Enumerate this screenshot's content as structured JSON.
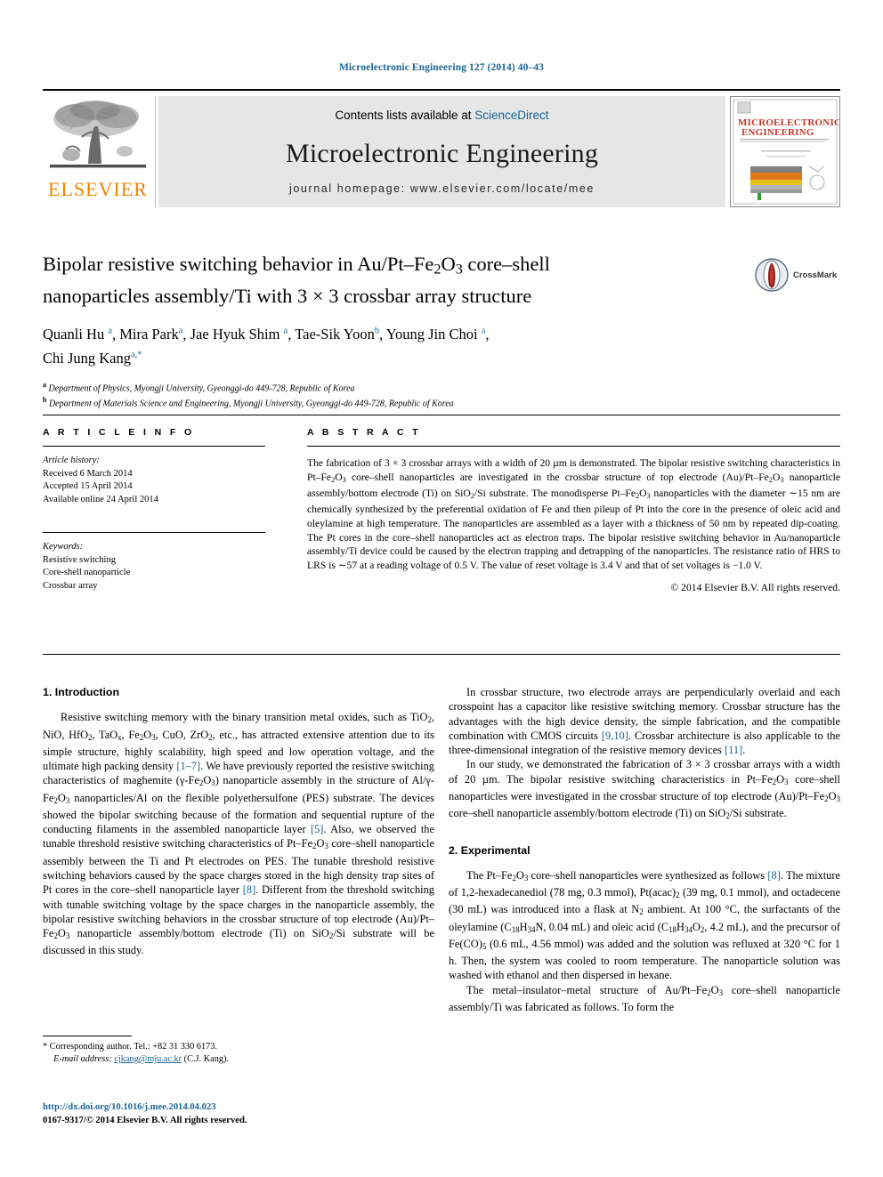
{
  "running_head": "Microelectronic Engineering 127 (2014) 40–43",
  "masthead": {
    "contents_label": "Contents lists available at",
    "sciencedirect_link": "ScienceDirect",
    "journal_title": "Microelectronic Engineering",
    "homepage_label": "journal homepage: www.elsevier.com/locate/mee",
    "publisher_wordmark": "ELSEVIER",
    "cover_title_line1": "MICROELECTRONIC",
    "cover_title_line2": "ENGINEERING"
  },
  "article": {
    "title_line1": "Bipolar resistive switching behavior in Au/Pt–Fe2O3 core–shell",
    "title_line2": "nanoparticles assembly/Ti with 3 × 3 crossbar array structure",
    "authors": "Quanli Hu a, Mira Park a, Jae Hyuk Shim a, Tae-Sik Yoon b, Young Jin Choi a, Chi Jung Kang a,*",
    "affiliation_a": "Department of Physics, Myongji University, Gyeonggi-do 449-728, Republic of Korea",
    "affiliation_b": "Department of Materials Science and Engineering, Myongji University, Gyeonggi-do 449-728, Republic of Korea",
    "crossmark_label": "CrossMark"
  },
  "article_info": {
    "heading": "A R T I C L E    I N F O",
    "history_label": "Article history:",
    "received": "Received 6 March 2014",
    "accepted": "Accepted 15 April 2014",
    "available_online": "Available online 24 April 2014",
    "keywords_label": "Keywords:",
    "keywords": [
      "Resistive switching",
      "Core-shell nanoparticle",
      "Crossbar array"
    ]
  },
  "abstract": {
    "heading": "A B S T R A C T",
    "text": "The fabrication of 3 × 3 crossbar arrays with a width of 20 µm is demonstrated. The bipolar resistive switching characteristics in Pt–Fe2O3 core–shell nanoparticles are investigated in the crossbar structure of top electrode (Au)/Pt–Fe2O3 nanoparticle assembly/bottom electrode (Ti) on SiO2/Si substrate. The monodisperse Pt–Fe2O3 nanoparticles with the diameter ~15 nm are chemically synthesized by the preferential oxidation of Fe and then pileup of Pt into the core in the presence of oleic acid and oleylamine at high temperature. The nanoparticles are assembled as a layer with a thickness of 50 nm by repeated dip-coating. The Pt cores in the core–shell nanoparticles act as electron traps. The bipolar resistive switching behavior in Au/nanoparticle assembly/Ti device could be caused by the electron trapping and detrapping of the nanoparticles. The resistance ratio of HRS to LRS is ~57 at a reading voltage of 0.5 V. The value of reset voltage is 3.4 V and that of set voltages is −1.0 V.",
    "copyright": "© 2014 Elsevier B.V. All rights reserved."
  },
  "sections": {
    "introduction_heading": "1. Introduction",
    "experimental_heading": "2. Experimental",
    "intro_p1": "Resistive switching memory with the binary transition metal oxides, such as TiO2, NiO, HfO2, TaOx, Fe2O3, CuO, ZrO2, etc., has attracted extensive attention due to its simple structure, highly scalability, high speed and low operation voltage, and the ultimate high packing density [1–7]. We have previously reported the resistive switching characteristics of maghemite (γ-Fe2O3) nanoparticle assembly in the structure of Al/γ-Fe2O3 nanoparticles/Al on the flexible polyethersulfone (PES) substrate. The devices showed the bipolar switching because of the formation and sequential rupture of the conducting filaments in the assembled nanoparticle layer [5]. Also, we observed the tunable threshold resistive switching characteristics of Pt–Fe2O3 core–shell nanoparticle assembly between the Ti and Pt electrodes on PES. The tunable threshold resistive switching behaviors caused by the space charges stored in the high density trap sites of Pt cores in the core–shell nanoparticle layer [8]. Different from the threshold switching with tunable switching voltage by the space charges in the nanoparticle assembly, the bipolar resistive switching behaviors in the crossbar structure of top electrode (Au)/Pt–Fe2O3 nanoparticle assembly/bottom electrode (Ti) on SiO2/Si substrate will be discussed in this study.",
    "intro_p2": "In crossbar structure, two electrode arrays are perpendicularly overlaid and each crosspoint has a capacitor like resistive switching memory. Crossbar structure has the advantages with the high device density, the simple fabrication, and the compatible combination with CMOS circuits [9,10]. Crossbar architecture is also applicable to the three-dimensional integration of the resistive memory devices [11].",
    "intro_p3": "In our study, we demonstrated the fabrication of 3 × 3 crossbar arrays with a width of 20 µm. The bipolar resistive switching characteristics in Pt–Fe2O3 core–shell nanoparticles were investigated in the crossbar structure of top electrode (Au)/Pt–Fe2O3 core–shell nanoparticle assembly/bottom electrode (Ti) on SiO2/Si substrate.",
    "exp_p1": "The Pt–Fe2O3 core–shell nanoparticles were synthesized as follows [8]. The mixture of 1,2-hexadecanediol (78 mg, 0.3 mmol), Pt(acac)2 (39 mg, 0.1 mmol), and octadecene (30 mL) was introduced into a flask at N2 ambient. At 100 °C, the surfactants of the oleylamine (C18H34N, 0.04 mL) and oleic acid (C18H34O2, 4.2 mL), and the precursor of Fe(CO)5 (0.6 mL, 4.56 mmol) was added and the solution was refluxed at 320 °C for 1 h. Then, the system was cooled to room temperature. The nanoparticle solution was washed with ethanol and then dispersed in hexane.",
    "exp_p2": "The metal–insulator–metal structure of Au/Pt–Fe2O3 core–shell nanoparticle assembly/Ti was fabricated as follows. To form the"
  },
  "footer": {
    "corresponding_marker": "*",
    "corresponding_text": "Corresponding author. Tel.: +82 31 330 6173.",
    "email_label": "E-mail address:",
    "email": "cjkang@mju.ac.kr",
    "email_owner": "(C.J. Kang).",
    "doi": "http://dx.doi.org/10.1016/j.mee.2014.04.023",
    "issn_line": "0167-9317/© 2014 Elsevier B.V. All rights reserved."
  },
  "colors": {
    "link": "#1a6496",
    "elsevier_orange": "#ef8200",
    "masthead_gray": "#e6e6e6"
  }
}
